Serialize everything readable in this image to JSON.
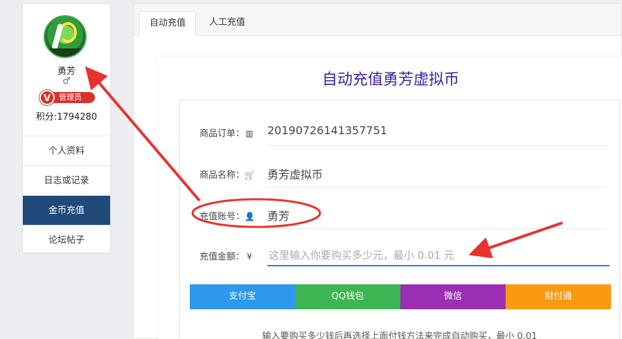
{
  "sidebar": {
    "username": "勇芳",
    "role": "管理员",
    "role_badge_letter": "V",
    "points": "积分:1794280",
    "menu": [
      {
        "label": "个人资料"
      },
      {
        "label": "日志或记录"
      },
      {
        "label": "金币充值",
        "active": true
      },
      {
        "label": "论坛帖子"
      }
    ]
  },
  "tabs": [
    {
      "label": "自动充值",
      "active": true
    },
    {
      "label": "人工充值",
      "active": false
    }
  ],
  "page": {
    "title": "自动充值勇芳虚拟币"
  },
  "form": {
    "order": {
      "label": "商品订单：",
      "value": "20190726141357751",
      "icon": "barcode-icon"
    },
    "product": {
      "label": "商品名称：",
      "value": "勇芳虚拟币",
      "icon": "cart-icon"
    },
    "account": {
      "label": "充值账号：",
      "value": "勇芳",
      "icon": "user-icon"
    },
    "amount": {
      "label": "充值金额：",
      "placeholder": "这里输入你要购买多少元，最小 0.01 元",
      "value": "",
      "icon": "yen-icon"
    }
  },
  "payment": {
    "alipay": "支付宝",
    "qq": "QQ钱包",
    "wechat": "微信",
    "tenpay": "财付通"
  },
  "hint": "输入要购买多少钱后再选择上面付钱方法来完成自动购买，最小 0.01",
  "colors": {
    "active_menu": "#1f4a7a",
    "title": "#3a1fa0",
    "input_focus": "#2b7fd6",
    "annotation": "#e8322e",
    "alipay": "#2c98ee",
    "qq": "#3db553",
    "wechat": "#9b2fb3",
    "tenpay": "#f99a12"
  }
}
